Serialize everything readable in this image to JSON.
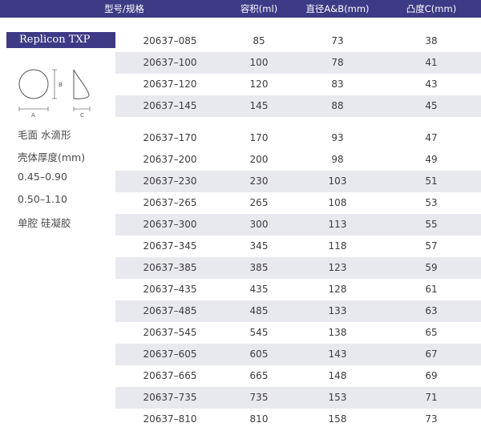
{
  "header": {
    "model": "型号/规格",
    "volume": "容积(ml)",
    "diameter": "直径A&B(mm)",
    "projection": "凸度C(mm)"
  },
  "side": {
    "title": "Replicon TXP",
    "drawing_labels": {
      "a": "A",
      "b": "B",
      "c": "C"
    },
    "specs": [
      "毛面 水滴形",
      "壳体厚度(mm)",
      "0.45–0.90",
      "0.50–1.10",
      "单腔 硅凝胶"
    ]
  },
  "colors": {
    "header_bg": "#3d3a86",
    "row_shade": "#e8e8ef"
  },
  "rows": [
    {
      "model": "20637–085",
      "volume": "85",
      "diameter": "73",
      "projection": "38"
    },
    {
      "model": "20637–100",
      "volume": "100",
      "diameter": "78",
      "projection": "41"
    },
    {
      "model": "20637–120",
      "volume": "120",
      "diameter": "83",
      "projection": "43"
    },
    {
      "model": "20637–145",
      "volume": "145",
      "diameter": "88",
      "projection": "45"
    },
    {
      "model": "20637–170",
      "volume": "170",
      "diameter": "93",
      "projection": "47"
    },
    {
      "model": "20637–200",
      "volume": "200",
      "diameter": "98",
      "projection": "49"
    },
    {
      "model": "20637–230",
      "volume": "230",
      "diameter": "103",
      "projection": "51"
    },
    {
      "model": "20637–265",
      "volume": "265",
      "diameter": "108",
      "projection": "53"
    },
    {
      "model": "20637–300",
      "volume": "300",
      "diameter": "113",
      "projection": "55"
    },
    {
      "model": "20637–345",
      "volume": "345",
      "diameter": "118",
      "projection": "57"
    },
    {
      "model": "20637–385",
      "volume": "385",
      "diameter": "123",
      "projection": "59"
    },
    {
      "model": "20637–435",
      "volume": "435",
      "diameter": "128",
      "projection": "61"
    },
    {
      "model": "20637–485",
      "volume": "485",
      "diameter": "133",
      "projection": "63"
    },
    {
      "model": "20637–545",
      "volume": "545",
      "diameter": "138",
      "projection": "65"
    },
    {
      "model": "20637–605",
      "volume": "605",
      "diameter": "143",
      "projection": "67"
    },
    {
      "model": "20637–665",
      "volume": "665",
      "diameter": "148",
      "projection": "69"
    },
    {
      "model": "20637–735",
      "volume": "735",
      "diameter": "153",
      "projection": "71"
    },
    {
      "model": "20637–810",
      "volume": "810",
      "diameter": "158",
      "projection": "73"
    }
  ]
}
